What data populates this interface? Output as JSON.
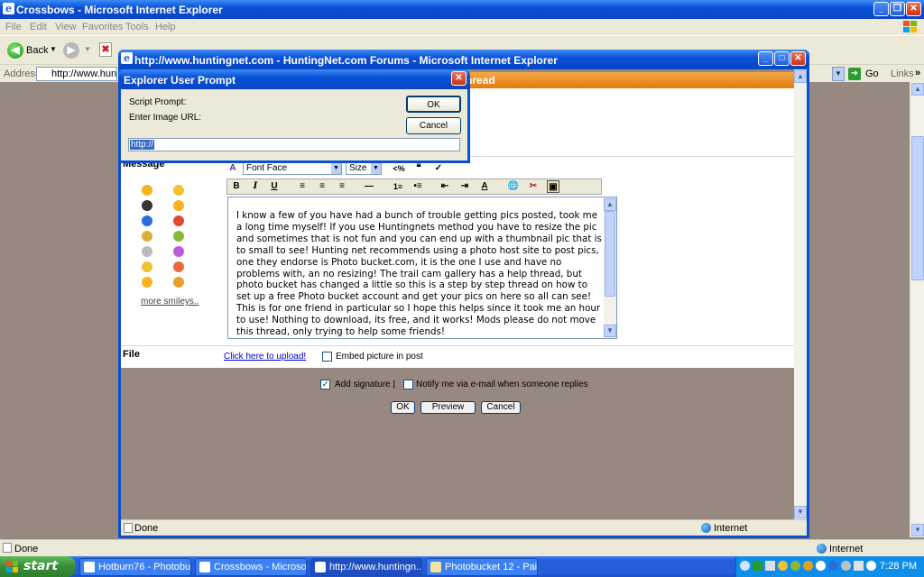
{
  "outer": {
    "title": "Crossbows - Microsoft Internet Explorer",
    "menu": [
      "File",
      "Edit",
      "View",
      "Favorites",
      "Tools",
      "Help"
    ],
    "back_label": "Back",
    "address_label": "Address",
    "address_value": "http://www.huntin",
    "go_label": "Go",
    "links_label": "Links",
    "status": "Done",
    "zone": "Internet"
  },
  "inner": {
    "title": "http://www.huntingnet.com - HuntingNet.com Forums - Microsoft Internet Explorer",
    "header_text": "hread",
    "message_label": "Message",
    "font_face": "Font Face",
    "size": "Size",
    "more_smileys": "more smileys..",
    "message_text": "I know a few of you have had a bunch of trouble getting pics posted, took me a long time myself!  If you use Huntingnets method you have to resize the pic and sometimes that is not fun and you can end up with a thumbnail pic that is to small to see!  Hunting net recommends using a photo host site to post pics, one they endorse is Photo bucket.com, it is the one I use and have no problems with, an no resizing!  The trail cam gallery has a help thread, but photo bucket has changed a little so this is a step by step thread on how to set up a free Photo bucket account and get your pics on here so all can see!  This is for one friend in particular so I hope this helps since it took me an hour to use!  Nothing to download, its free, and it works!  Mods please do not move this thread, only trying to help some friends!",
    "file_label": "File",
    "upload_link": "Click here to upload!",
    "embed_label": "Embed picture in post",
    "add_signature": "Add signature |",
    "notify_label": "Notify me via e-mail when someone replies",
    "ok": "OK",
    "preview": "Preview",
    "cancel": "Cancel",
    "status": "Done",
    "zone": "Internet"
  },
  "dialog": {
    "title": "Explorer User Prompt",
    "script_prompt": "Script Prompt:",
    "prompt_text": "Enter Image URL:",
    "ok": "OK",
    "cancel": "Cancel",
    "url_value": "http://"
  },
  "taskbar": {
    "start": "start",
    "tasks": [
      "Hotburn76 - Photobu...",
      "Crossbows - Microsof...",
      "http://www.huntingn...",
      "Photobucket 12 - Paint"
    ],
    "clock": "7:28 PM"
  },
  "colors": {
    "xp_blue": "#0a50d6",
    "taskbar_green": "#378d37",
    "forum_orange": "#e07d10",
    "page_bg": "#978880"
  }
}
